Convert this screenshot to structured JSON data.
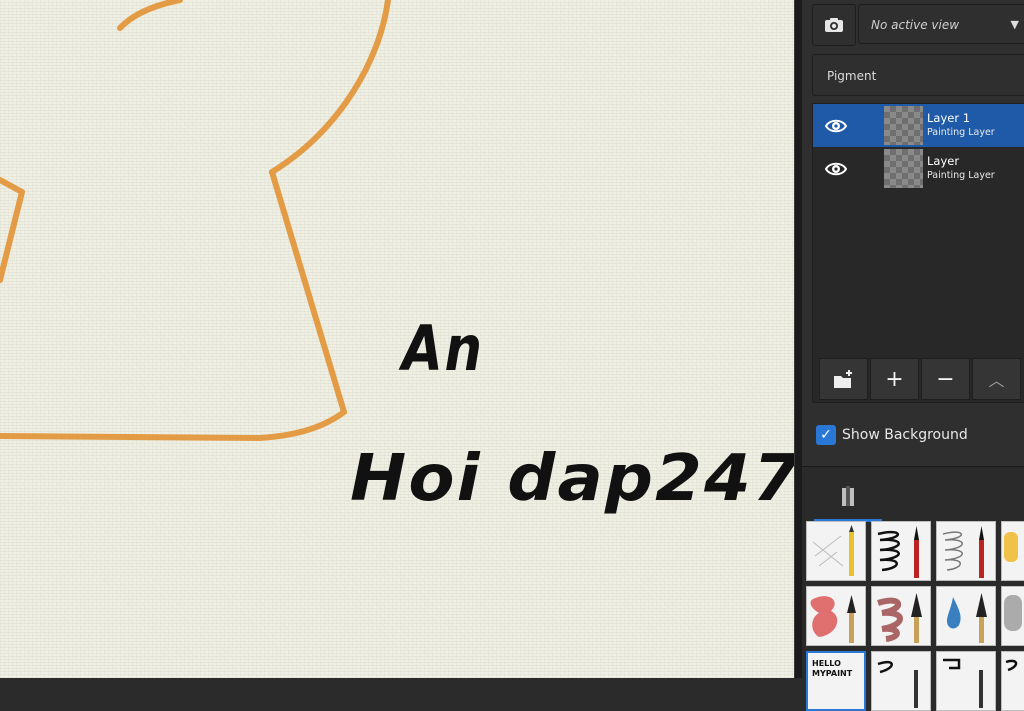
{
  "canvas": {
    "handwriting_line1": "An",
    "handwriting_line2": "Hoi dap247",
    "stroke_color": "#e39c45",
    "ink_color": "#111111"
  },
  "panel": {
    "camera_icon": "camera-icon",
    "view_select_value": "No active view",
    "mode_select_value": "Pigment",
    "layers": [
      {
        "name": "Layer 1",
        "type": "Painting Layer",
        "selected": true,
        "visible": true
      },
      {
        "name": "Layer",
        "type": "Painting Layer",
        "selected": false,
        "visible": true
      }
    ],
    "toolbar_icons": [
      "add-group-icon",
      "plus-icon",
      "minus-icon",
      "move-up-icon"
    ],
    "show_background_label": "Show Background",
    "show_background_checked": true,
    "brush_cell_text": "HELLO MYPAINT",
    "accent_color": "#2a78d6",
    "selected_row_color": "#1f5aa8"
  }
}
